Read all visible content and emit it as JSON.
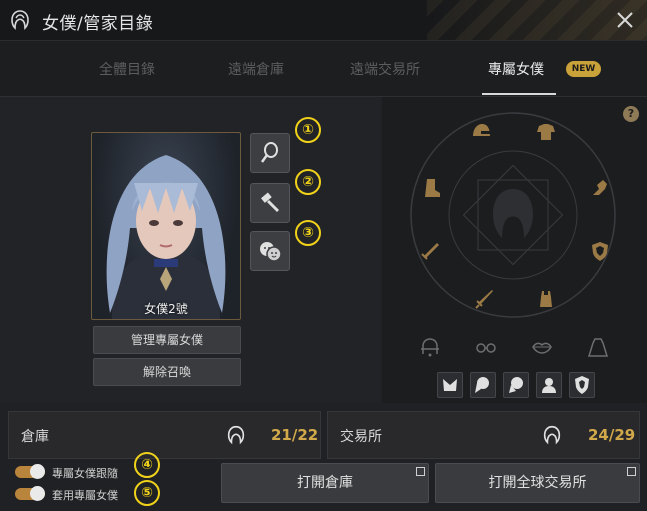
{
  "window": {
    "title": "女僕/管家目錄"
  },
  "tabs": [
    {
      "label": "全體目錄"
    },
    {
      "label": "遠端倉庫"
    },
    {
      "label": "遠端交易所"
    },
    {
      "label": "專屬女僕"
    }
  ],
  "new_badge": "NEW",
  "portrait": {
    "name": "女僕2號"
  },
  "actions": {
    "manage_label": "管理專屬女僕",
    "dismiss_label": "解除召喚"
  },
  "markers": [
    "①",
    "②",
    "③",
    "④",
    "⑤"
  ],
  "help": "?",
  "side_buttons": [
    "mirror-icon",
    "hammer-icon",
    "emotes-icon"
  ],
  "equip_slots": [
    "helmet-icon",
    "top-icon",
    "boots-icon",
    "gloves-icon",
    "sword-icon",
    "shield-icon",
    "dagger-icon",
    "outfit-icon",
    "earring-icon",
    "glasses-icon",
    "lips-icon",
    "cloak-icon"
  ],
  "appearance_icons": [
    "hairstyle-1-icon",
    "hairstyle-2-icon",
    "hairstyle-3-icon",
    "bust-icon",
    "badge-icon"
  ],
  "storage": {
    "label": "倉庫",
    "count": "21/22"
  },
  "market": {
    "label": "交易所",
    "count": "24/29"
  },
  "toggles": {
    "follow_label": "專屬女僕跟隨",
    "apply_label": "套用專屬女僕",
    "follow_on": true,
    "apply_on": true
  },
  "buttons": {
    "open_storage": "打開倉庫",
    "open_market": "打開全球交易所"
  },
  "colors": {
    "accent": "#c9a23a",
    "count": "#d2a94a",
    "marker": "#f0d21a"
  }
}
